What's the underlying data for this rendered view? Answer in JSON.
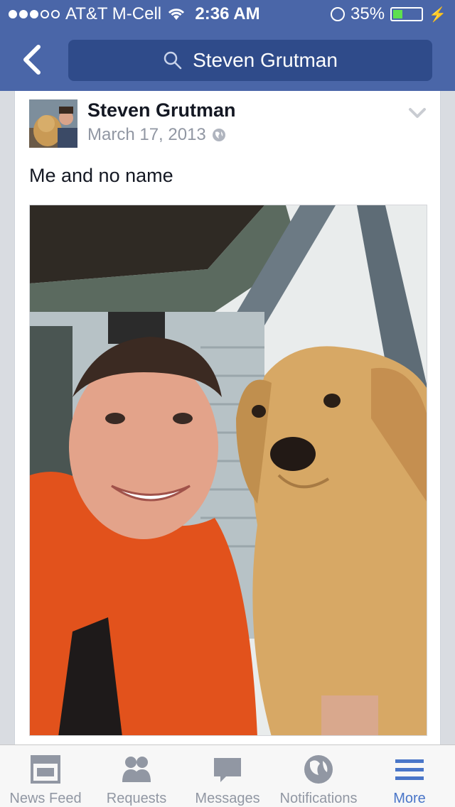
{
  "status_bar": {
    "carrier": "AT&T M-Cell",
    "time": "2:36 AM",
    "battery": "35%",
    "battery_level": 0.35,
    "signal_bars": 3
  },
  "nav": {
    "back_icon": "chevron-left-icon",
    "search_text": "Steven Grutman"
  },
  "post": {
    "author": "Steven Grutman",
    "date": "March 17, 2013",
    "privacy_icon": "globe-icon",
    "message": "Me and no name"
  },
  "tabs": [
    {
      "label": "News Feed",
      "icon": "news-feed-icon",
      "active": false
    },
    {
      "label": "Requests",
      "icon": "friends-icon",
      "active": false
    },
    {
      "label": "Messages",
      "icon": "chat-bubble-icon",
      "active": false
    },
    {
      "label": "Notifications",
      "icon": "globe-icon",
      "active": false
    },
    {
      "label": "More",
      "icon": "menu-icon",
      "active": true
    }
  ],
  "colors": {
    "brand": "#4a66a8",
    "search_bg": "#2f4b8a",
    "active_tab": "#4a76c8",
    "inactive_tab": "#9197a3"
  }
}
